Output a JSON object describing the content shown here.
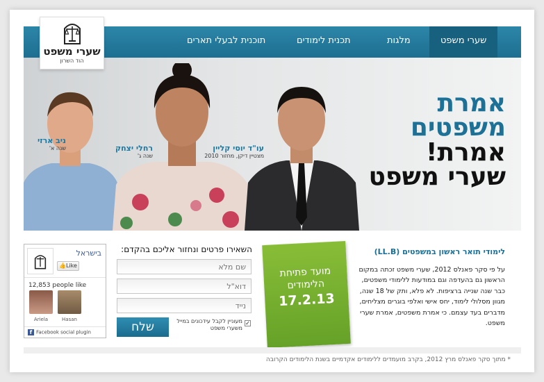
{
  "nav": {
    "items": [
      {
        "label": "שערי משפט",
        "active": true
      },
      {
        "label": "מלגות",
        "active": false
      },
      {
        "label": "תכנית לימודים",
        "active": false
      },
      {
        "label": "תוכנית לבעלי תארים",
        "active": false
      }
    ]
  },
  "logo": {
    "title": "שערי משפט",
    "subtitle": "הוד השרון"
  },
  "hero": {
    "slogan": [
      "אמרת",
      "משפטים",
      "אמרת!",
      "שערי משפט"
    ],
    "people": [
      {
        "name": "עו\"ד יוסי קליין",
        "subtitle": "מצטיין דיקן, מחזור 2010"
      },
      {
        "name": "רחלי יצחק",
        "subtitle": "שנה ג'"
      },
      {
        "name": "ניב ארזי",
        "subtitle": "שנה א'"
      }
    ]
  },
  "facebook": {
    "page_name": "בישראל",
    "like_label": "Like",
    "count_text": "12,853 people like",
    "fans": [
      "Ariela",
      "Hasan"
    ],
    "footer": "Facebook social plugin"
  },
  "form": {
    "title": "השאירו פרטים ונחזור אליכם בהקדם:",
    "name_placeholder": "שם מלא",
    "email_placeholder": "דוא\"ל",
    "phone_placeholder": "נייד",
    "checkbox_label": "מעוניין לקבל עידכונים במייל משערי משפט",
    "submit_label": "שלח"
  },
  "promo": {
    "line1": "מועד פתיחת",
    "line2": "הלימודים",
    "date": "17.2.13"
  },
  "info": {
    "title": "לימודי תואר ראשון במשפטים (LL.B)",
    "body": "על פי סקר פאנלס 2012, שערי משפט זכתה במקום הראשון גם בהעדפה וגם במודעות ללימודי משפטים, כבר שנה שנייה ברציפות. לא פלא, ותק של 18 שנה, מגוון מסלולי לימוד, יחס אישי ואלפי בוגרים מצליחים, מדברים בעד עצמם. כי אמרת משפטים, אמרת שערי משפט."
  },
  "footnote": "* מתוך סקר פאנלס מרץ 2012, בקרב מועמדים ללימודים אקדמיים בשנת הלימודים הקרובה",
  "colors": {
    "brand": "#1d7196",
    "nav": "#2c86a8",
    "promo": "#78b131"
  }
}
